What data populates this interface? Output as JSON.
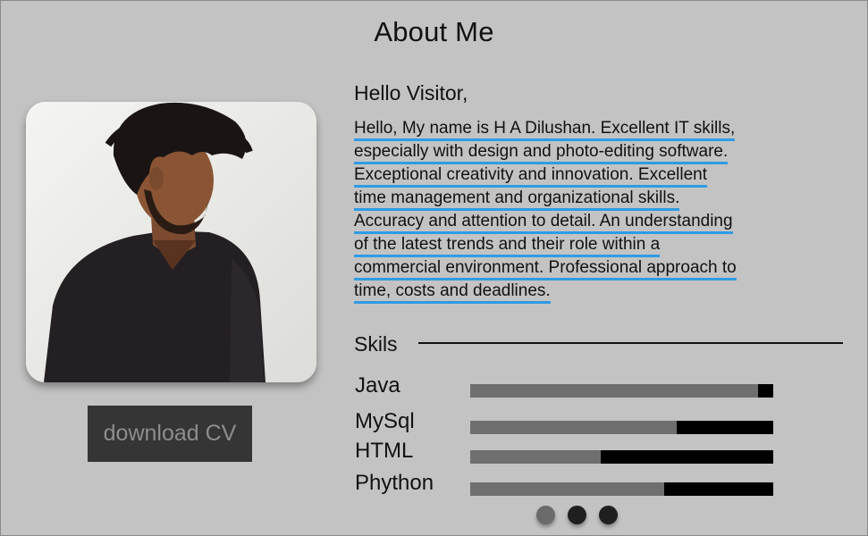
{
  "page": {
    "title": "About Me"
  },
  "intro": {
    "greeting": "Hello Visitor,",
    "bio_lines": [
      "Hello, My name is H A Dilushan. Excellent IT skills,",
      "especially with design and photo-editing software.",
      "Exceptional creativity and innovation. Excellent",
      "time management and organizational skills.",
      "Accuracy and attention to detail. An understanding",
      "of the latest trends and their role within a",
      "commercial environment. Professional approach to",
      "time, costs and deadlines."
    ]
  },
  "profile": {
    "download_label": "download CV"
  },
  "skills": {
    "heading": "Skils",
    "items": [
      {
        "name": "Java",
        "level": 0.95
      },
      {
        "name": "MySql",
        "level": 0.68
      },
      {
        "name": "HTML",
        "level": 0.43
      },
      {
        "name": "Phython",
        "level": 0.64
      }
    ]
  },
  "pagination": {
    "count": 3,
    "active_index": 0
  },
  "colors": {
    "background": "#c3c3c3",
    "underline_accent": "#2f9be5",
    "button_bg": "#353535",
    "button_text": "#8d8d8d",
    "bar_fill": "#6f6f6f",
    "bar_track": "#000000"
  }
}
